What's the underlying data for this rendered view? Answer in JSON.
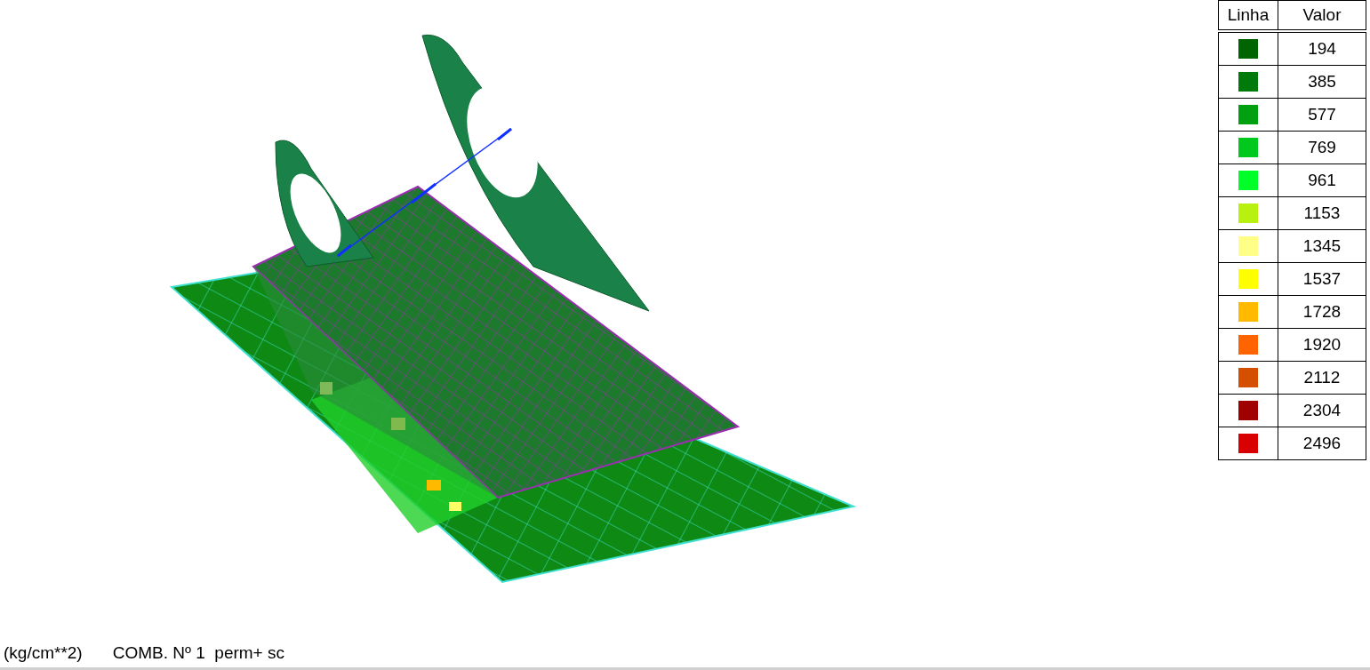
{
  "legend": {
    "columns": [
      "Linha",
      "Valor"
    ],
    "rows": [
      {
        "color": "#006400",
        "value": "194"
      },
      {
        "color": "#007a0a",
        "value": "385"
      },
      {
        "color": "#00a010",
        "value": "577"
      },
      {
        "color": "#00c81c",
        "value": "769"
      },
      {
        "color": "#00ff28",
        "value": "961"
      },
      {
        "color": "#b8f010",
        "value": "1153"
      },
      {
        "color": "#ffff88",
        "value": "1345"
      },
      {
        "color": "#ffff00",
        "value": "1537"
      },
      {
        "color": "#ffba00",
        "value": "1728"
      },
      {
        "color": "#ff6400",
        "value": "1920"
      },
      {
        "color": "#d45000",
        "value": "2112"
      },
      {
        "color": "#a00000",
        "value": "2304"
      },
      {
        "color": "#d80000",
        "value": "2496"
      }
    ]
  },
  "status": {
    "units": "(kg/cm**2)",
    "combination": "COMB. Nº 1  perm+ sc"
  }
}
